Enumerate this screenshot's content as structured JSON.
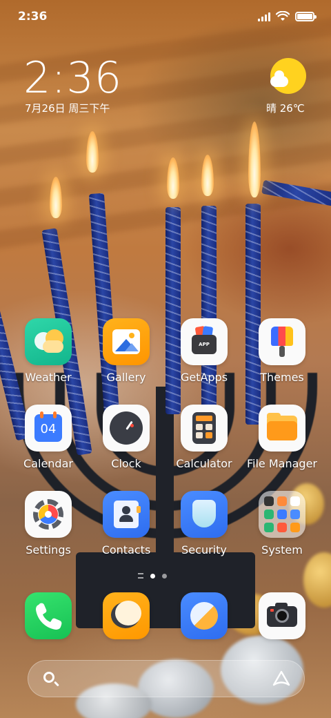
{
  "status_bar": {
    "time": "2:36"
  },
  "clock_widget": {
    "time": "2:36",
    "date": "7月26日 周三下午"
  },
  "weather_widget": {
    "text": "晴 26℃"
  },
  "apps": [
    {
      "label": "Weather",
      "icon": "weather-icon"
    },
    {
      "label": "Gallery",
      "icon": "gallery-icon"
    },
    {
      "label": "GetApps",
      "icon": "getapps-icon"
    },
    {
      "label": "Themes",
      "icon": "themes-icon"
    },
    {
      "label": "Calendar",
      "icon": "calendar-icon"
    },
    {
      "label": "Clock",
      "icon": "clock-icon"
    },
    {
      "label": "Calculator",
      "icon": "calculator-icon"
    },
    {
      "label": "File Manager",
      "icon": "file-manager-icon"
    },
    {
      "label": "Settings",
      "icon": "settings-icon"
    },
    {
      "label": "Contacts",
      "icon": "contacts-icon"
    },
    {
      "label": "Security",
      "icon": "security-icon"
    },
    {
      "label": "System",
      "icon": "folder-icon"
    }
  ],
  "calendar_day": "04",
  "getapps_badge": "APP",
  "dock": [
    {
      "icon": "phone-icon"
    },
    {
      "icon": "messages-icon"
    },
    {
      "icon": "browser-icon"
    },
    {
      "icon": "camera-icon"
    }
  ],
  "page_indicator": {
    "pages": 2,
    "active": 1
  },
  "search_bar": {
    "left_icon": "search-icon",
    "right_icon": "assistant-icon"
  },
  "colors": {
    "accent_blue": "#2e6df0",
    "weather_sun": "#ffd21f"
  }
}
